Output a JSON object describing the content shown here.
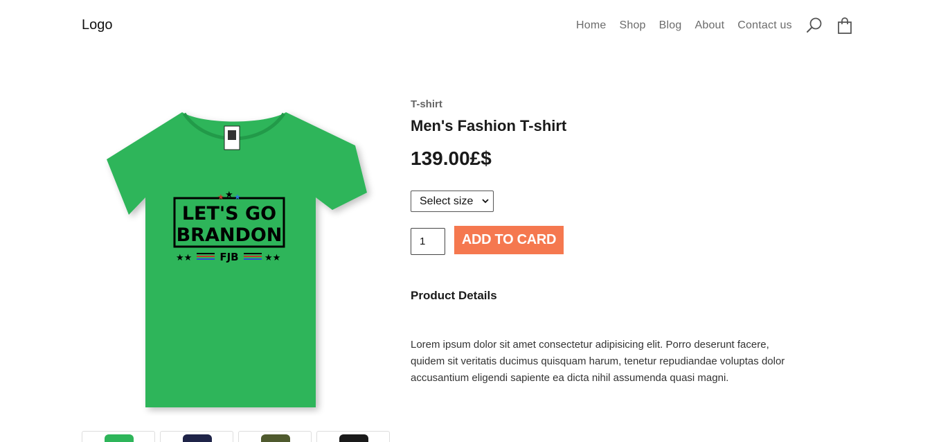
{
  "header": {
    "logo": "Logo",
    "nav": [
      "Home",
      "Shop",
      "Blog",
      "About",
      "Contact us"
    ],
    "icons": [
      "search-icon",
      "shopping-bag-icon"
    ]
  },
  "product": {
    "category": "T-shirt",
    "title": "Men's Fashion T-shirt",
    "price": "139.00£$",
    "size_select": "Select size",
    "quantity": "1",
    "add_button": "ADD TO CARD",
    "details_heading": "Product Details",
    "description": "Lorem ipsum dolor sit amet consectetur adipisicing elit. Porro deserunt facere, quidem sit veritatis ducimus quisquam harum, tenetur repudiandae voluptas dolor accusantium eligendi sapiente ea dicta nihil assumenda quasi magni.",
    "image": {
      "shirt_color": "#2eb55a",
      "print_lines": [
        "LET'S GO",
        "BRANDON",
        "FJB"
      ]
    },
    "thumbnail_colors": [
      "#2eb55a",
      "#1f2448",
      "#4f5a2e",
      "#1a1a1a"
    ]
  },
  "colors": {
    "accent": "#f5784f"
  }
}
